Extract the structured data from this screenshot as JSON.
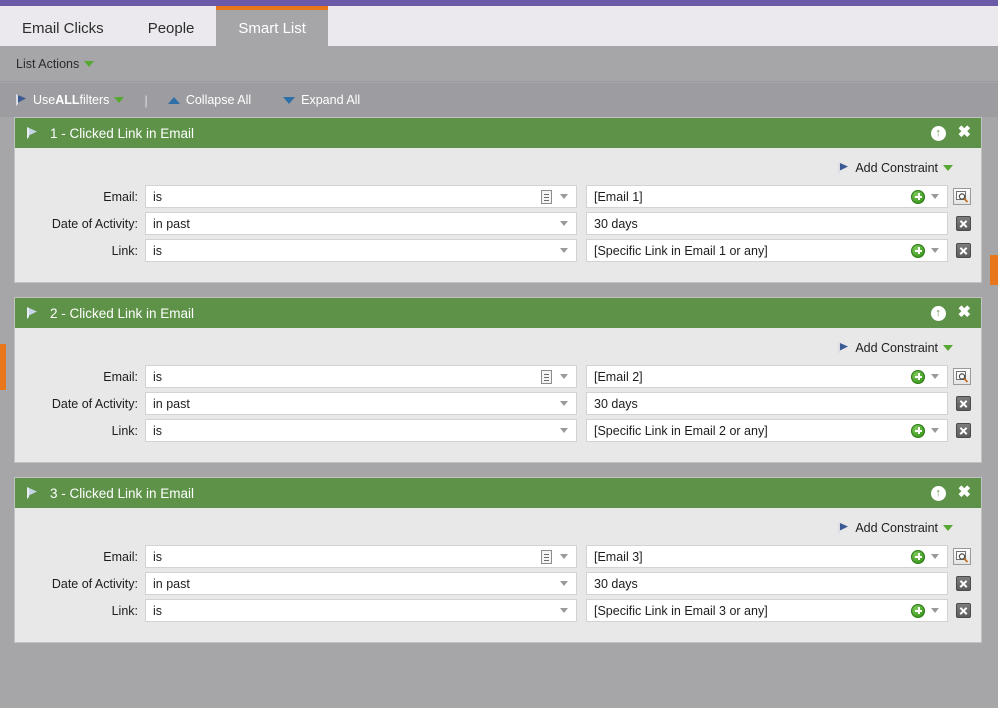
{
  "window": {
    "accent_purple": "#6b5aa8",
    "accent_orange": "#e8761a",
    "panel_green": "#5d9248",
    "background_gray": "#a6a6a9"
  },
  "tabs": [
    {
      "label": "Email Clicks",
      "active": false
    },
    {
      "label": "People",
      "active": false
    },
    {
      "label": "Smart List",
      "active": true
    }
  ],
  "action_bar": {
    "list_actions_label": "List Actions",
    "caret_icon": "caret-down-icon"
  },
  "filter_toolbar": {
    "use_prefix": "Use ",
    "use_strong": "ALL",
    "use_suffix": " filters",
    "separator": "|",
    "collapse_all": "Collapse All",
    "expand_all": "Expand All",
    "flag_icon": "flag-icon",
    "collapse_icon": "triangle-up-icon",
    "expand_icon": "triangle-down-icon"
  },
  "panels": [
    {
      "title": "1 - Clicked Link in Email",
      "collapse_icon": "up-arrow-circle-icon",
      "close_icon": "close-icon",
      "flag_icon": "flag-icon",
      "add_constraint_label": "Add Constraint",
      "rows": [
        {
          "label": "Email:",
          "operator": "is",
          "value": "[Email 1]",
          "has_doc_icon": true,
          "has_plus": true,
          "has_magnifier": true,
          "has_delete": false,
          "spellcheck_error": true
        },
        {
          "label": "Date of Activity:",
          "operator": "in past",
          "value": "30 days",
          "has_doc_icon": false,
          "has_plus": false,
          "has_magnifier": false,
          "has_delete": true,
          "spellcheck_error": false
        },
        {
          "label": "Link:",
          "operator": "is",
          "value": "[Specific Link in Email 1 or any]",
          "has_doc_icon": false,
          "has_plus": true,
          "has_magnifier": false,
          "has_delete": true,
          "spellcheck_error": false
        }
      ]
    },
    {
      "title": "2 - Clicked Link in Email",
      "collapse_icon": "up-arrow-circle-icon",
      "close_icon": "close-icon",
      "flag_icon": "flag-icon",
      "add_constraint_label": "Add Constraint",
      "rows": [
        {
          "label": "Email:",
          "operator": "is",
          "value": "[Email 2]",
          "has_doc_icon": true,
          "has_plus": true,
          "has_magnifier": true,
          "has_delete": false,
          "spellcheck_error": false
        },
        {
          "label": "Date of Activity:",
          "operator": "in past",
          "value": "30 days",
          "has_doc_icon": false,
          "has_plus": false,
          "has_magnifier": false,
          "has_delete": true,
          "spellcheck_error": false
        },
        {
          "label": "Link:",
          "operator": "is",
          "value": "[Specific Link in Email 2 or any]",
          "has_doc_icon": false,
          "has_plus": true,
          "has_magnifier": false,
          "has_delete": true,
          "spellcheck_error": false
        }
      ]
    },
    {
      "title": "3 - Clicked Link in Email",
      "collapse_icon": "up-arrow-circle-icon",
      "close_icon": "close-icon",
      "flag_icon": "flag-icon",
      "add_constraint_label": "Add Constraint",
      "rows": [
        {
          "label": "Email:",
          "operator": "is",
          "value": "[Email 3]",
          "has_doc_icon": true,
          "has_plus": true,
          "has_magnifier": true,
          "has_delete": false,
          "spellcheck_error": false
        },
        {
          "label": "Date of Activity:",
          "operator": "in past",
          "value": "30 days",
          "has_doc_icon": false,
          "has_plus": false,
          "has_magnifier": false,
          "has_delete": true,
          "spellcheck_error": false
        },
        {
          "label": "Link:",
          "operator": "is",
          "value": "[Specific Link in Email 3 or any]",
          "has_doc_icon": false,
          "has_plus": true,
          "has_magnifier": false,
          "has_delete": true,
          "spellcheck_error": false
        }
      ]
    }
  ]
}
